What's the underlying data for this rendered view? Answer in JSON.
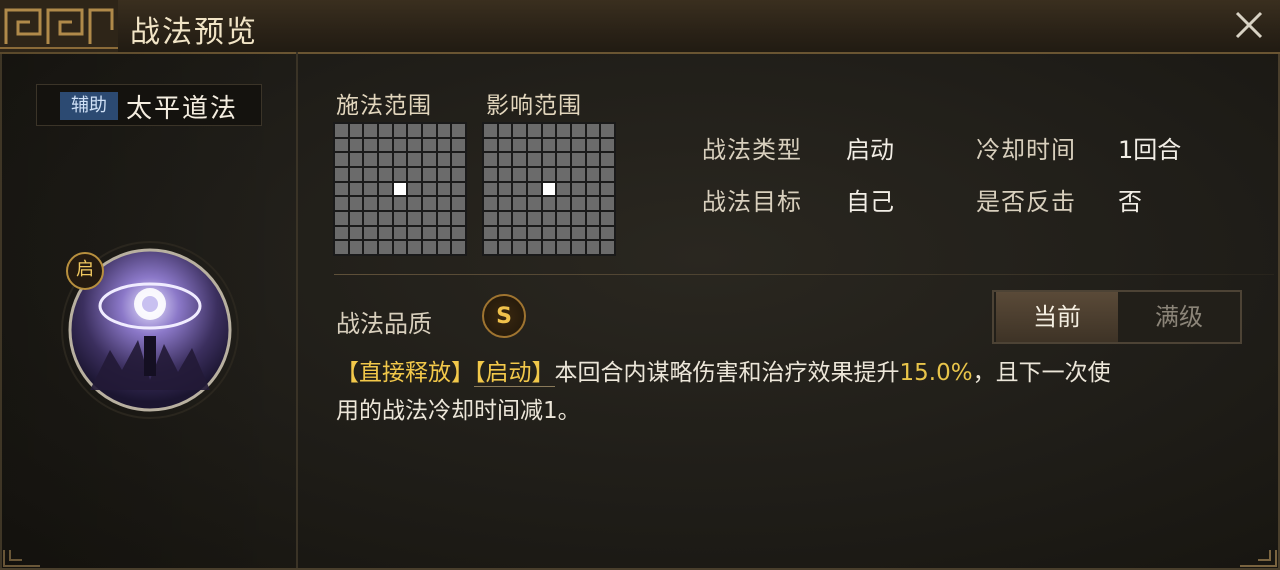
{
  "window": {
    "title": "战法预览"
  },
  "skill": {
    "tag": "辅助",
    "name": "太平道法",
    "trigger_badge": "启"
  },
  "ranges": {
    "cast_range_label": "施法范围",
    "effect_range_label": "影响范围"
  },
  "info": {
    "type_label": "战法类型",
    "type_value": "启动",
    "cooldown_label": "冷却时间",
    "cooldown_value": "1回合",
    "target_label": "战法目标",
    "target_value": "自己",
    "counter_label": "是否反击",
    "counter_value": "否"
  },
  "quality": {
    "label": "战法品质",
    "grade": "S"
  },
  "level_toggle": {
    "current": "当前",
    "max": "满级",
    "selected": "current"
  },
  "description": {
    "tag1": "【直接释放】",
    "tag2": "【启动】",
    "text1": "本回合内谋略伤害和治疗效果提升",
    "value": "15.0%",
    "text2": "，且下一次使",
    "line2": "用的战法冷却时间减1。"
  },
  "colors": {
    "accent_gold": "#f2c84a",
    "tag_blue": "#2c4a72",
    "frame_brown": "#6a5532"
  }
}
